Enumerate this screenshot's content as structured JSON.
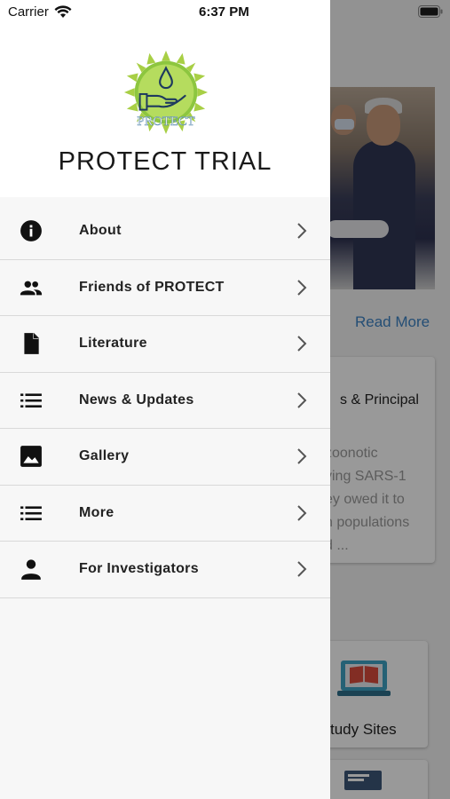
{
  "status_bar": {
    "carrier": "Carrier",
    "time": "6:37 PM"
  },
  "drawer": {
    "logo_text": "PROTECT",
    "title": "PROTECT TRIAL",
    "items": [
      {
        "label": "About",
        "icon": "info-icon"
      },
      {
        "label": "Friends of PROTECT",
        "icon": "people-icon"
      },
      {
        "label": "Literature",
        "icon": "document-icon"
      },
      {
        "label": "News & Updates",
        "icon": "list-icon"
      },
      {
        "label": "Gallery",
        "icon": "image-icon"
      },
      {
        "label": "More",
        "icon": "list-icon"
      },
      {
        "label": "For Investigators",
        "icon": "person-icon"
      }
    ]
  },
  "background": {
    "read_more": "Read More",
    "card_title": "s & Principal",
    "card_body_lines": [
      "zoonotic",
      "ving SARS-1",
      "ey owed it to",
      "n populations",
      "d ..."
    ],
    "study_sites": "tudy Sites"
  },
  "colors": {
    "accent": "#3d82c4",
    "logo_green": "#8dc63f",
    "drawer_bg": "#f7f7f7"
  }
}
